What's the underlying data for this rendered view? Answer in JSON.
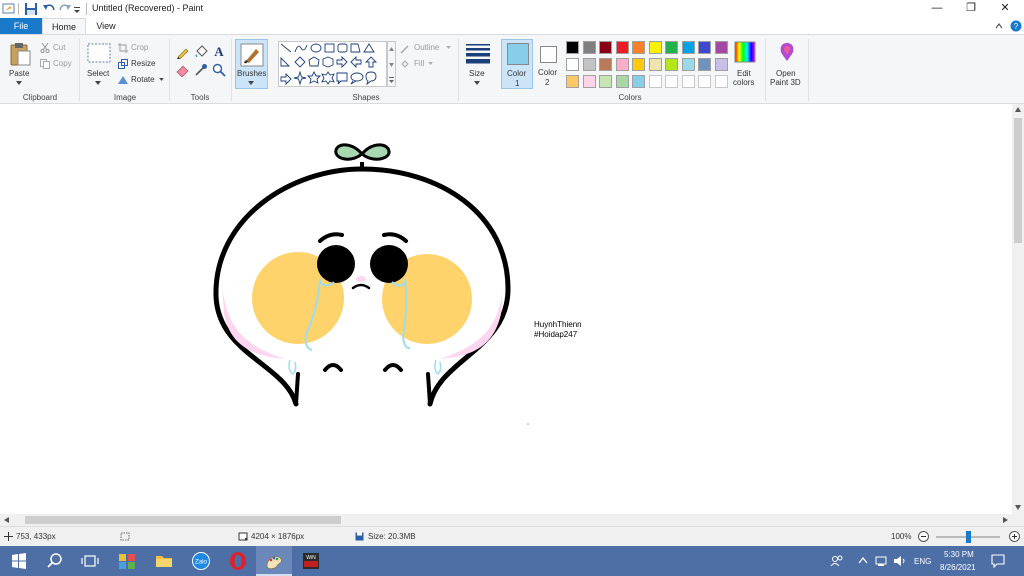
{
  "window": {
    "title": "Untitled (Recovered) - Paint",
    "controls": {
      "minimize": "—",
      "restore": "❐",
      "close": "✕"
    }
  },
  "tabs": {
    "file": "File",
    "home": "Home",
    "view": "View"
  },
  "ribbon": {
    "clipboard": {
      "label": "Clipboard",
      "paste": "Paste",
      "cut": "Cut",
      "copy": "Copy"
    },
    "image": {
      "label": "Image",
      "select": "Select",
      "crop": "Crop",
      "resize": "Resize",
      "rotate": "Rotate"
    },
    "tools": {
      "label": "Tools"
    },
    "brushes": {
      "label": "Brushes"
    },
    "shapes": {
      "label": "Shapes",
      "outline": "Outline",
      "fill": "Fill"
    },
    "size": {
      "label": "Size"
    },
    "color1": {
      "label": "Color",
      "num": "1",
      "value": "#87ceeb"
    },
    "color2": {
      "label": "Color",
      "num": "2",
      "value": "#ffffff"
    },
    "colors": {
      "label": "Colors",
      "row1": [
        "#000000",
        "#7f7f7f",
        "#880015",
        "#ed1c24",
        "#ff7f27",
        "#fff200",
        "#22b14c",
        "#00a2e8",
        "#3f48cc",
        "#a349a4"
      ],
      "row2": [
        "#ffffff",
        "#c3c3c3",
        "#b97a57",
        "#ffaec9",
        "#ffc90e",
        "#efe4b0",
        "#b5e61d",
        "#99d9ea",
        "#7092be",
        "#c8bfe7"
      ],
      "row3": [
        "#ffc864",
        "#ffd4e8",
        "#c8e6b4",
        "#a8d8a8",
        "#87ceeb"
      ]
    },
    "edit_colors": {
      "line1": "Edit",
      "line2": "colors"
    },
    "paint3d": {
      "line1": "Open",
      "line2": "Paint 3D"
    }
  },
  "canvas": {
    "signature_line1": "HuynhThienn",
    "signature_line2": "#Hoidap247",
    "colors": {
      "outline": "#000000",
      "cheek": "#ffd36b",
      "leaf": "#a8d8b0",
      "blush": "#ffd6f0",
      "tear": "#9fdcf0"
    }
  },
  "status": {
    "cursor": "753, 433px",
    "dimensions": "4204 × 1876px",
    "size": "Size: 20.3MB",
    "zoom": "100%"
  },
  "taskbar": {
    "time": "5:30 PM",
    "date": "8/26/2021",
    "lang": "ENG"
  }
}
